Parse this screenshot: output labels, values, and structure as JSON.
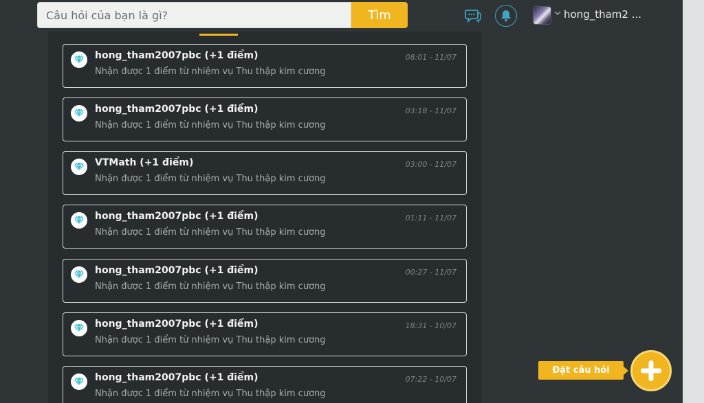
{
  "header": {
    "search_placeholder": "Câu hỏi của bạn là gì?",
    "search_button": "Tìm",
    "username": "hong_tham2 ...",
    "accent": "#f0b51f"
  },
  "notifications": [
    {
      "title": "hong_tham2007pbc (+1 điểm)",
      "desc": "Nhận được 1 điểm từ nhiệm vụ Thu thập kim cương",
      "time": "08:01 - 11/07"
    },
    {
      "title": "hong_tham2007pbc (+1 điểm)",
      "desc": "Nhận được 1 điểm từ nhiệm vụ Thu thập kim cương",
      "time": "03:18 - 11/07"
    },
    {
      "title": "VTMath (+1 điểm)",
      "desc": "Nhận được 1 điểm từ nhiệm vụ Thu thập kim cương",
      "time": "03:00 - 11/07"
    },
    {
      "title": "hong_tham2007pbc (+1 điểm)",
      "desc": "Nhận được 1 điểm từ nhiệm vụ Thu thập kim cương",
      "time": "01:11 - 11/07"
    },
    {
      "title": "hong_tham2007pbc (+1 điểm)",
      "desc": "Nhận được 1 điểm từ nhiệm vụ Thu thập kim cương",
      "time": "00:27 - 11/07"
    },
    {
      "title": "hong_tham2007pbc (+1 điểm)",
      "desc": "Nhận được 1 điểm từ nhiệm vụ Thu thập kim cương",
      "time": "18:31 - 10/07"
    },
    {
      "title": "hong_tham2007pbc (+1 điểm)",
      "desc": "Nhận được 1 điểm từ nhiệm vụ Thu thập kim cương",
      "time": "07:22 - 10/07"
    }
  ],
  "ask": {
    "label": "Đặt câu hỏi"
  },
  "icons": {
    "chat": "chat-bubbles-icon",
    "bell": "bell-icon",
    "gem": "diamond-icon",
    "plus": "plus-icon",
    "chevron": "chevron-down-icon"
  }
}
